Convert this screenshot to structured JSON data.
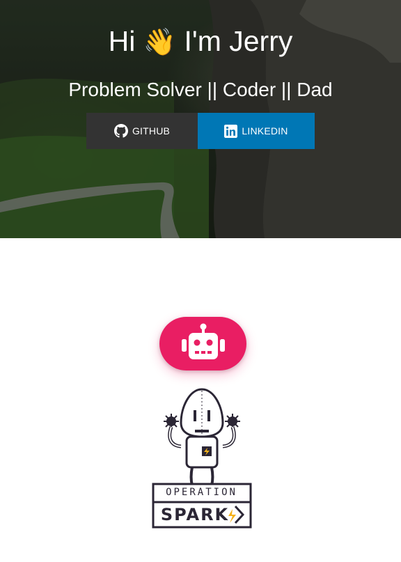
{
  "hero": {
    "greeting": "Hi",
    "wave_emoji": "👋",
    "name_text": "I'm Jerry",
    "subtitle": "Problem Solver || Coder || Dad",
    "buttons": [
      {
        "label": "GITHUB",
        "icon": "github-icon",
        "color": "#333333"
      },
      {
        "label": "LINKEDIN",
        "icon": "linkedin-icon",
        "color": "#0077b5"
      }
    ]
  },
  "robot_button": {
    "icon": "robot-icon",
    "color": "#e91e63"
  },
  "logo": {
    "line1": "OPERATION",
    "line2": "SPARK"
  }
}
